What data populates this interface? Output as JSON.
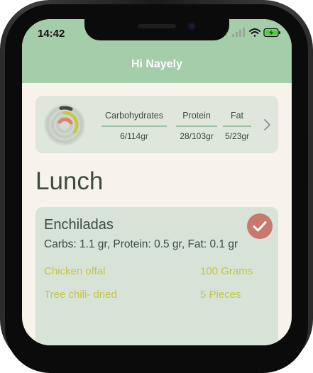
{
  "status_bar": {
    "time": "14:42"
  },
  "header": {
    "greeting": "Hi Nayely"
  },
  "macros": [
    {
      "label": "Carbohydrates",
      "value": "6/114gr",
      "color": "#c8c64a"
    },
    {
      "label": "Protein",
      "value": "28/103gr",
      "color": "#e27e6c"
    },
    {
      "label": "Fat",
      "value": "5/23gr",
      "color": "#3f4e45"
    }
  ],
  "colors": {
    "header": "#a4cdaa",
    "background": "#f7f3ea",
    "card": "#d7e3d7",
    "accent_check": "#c9786c",
    "ingredient_text": "#c3c54a"
  },
  "meal_section": {
    "title": "Lunch",
    "meal": {
      "name": "Enchiladas",
      "nutrition": "Carbs: 1.1 gr, Protein: 0.5 gr, Fat: 0.1 gr",
      "ingredients": [
        {
          "name": "Chicken offal",
          "amount": "100 Grams"
        },
        {
          "name": "Tree chili- dried",
          "amount": "5 Pieces"
        }
      ]
    }
  }
}
